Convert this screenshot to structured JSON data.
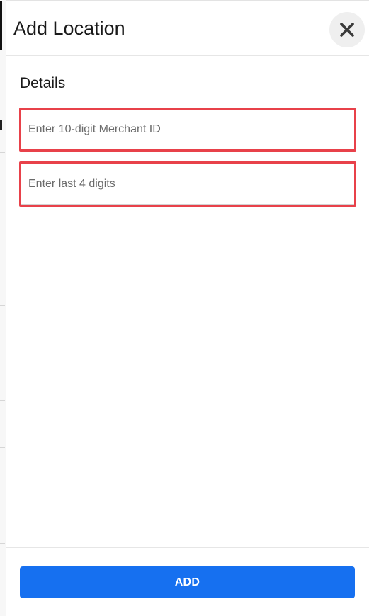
{
  "modal": {
    "title": "Add Location",
    "close_icon": "close-icon"
  },
  "details": {
    "section_title": "Details",
    "merchant_id": {
      "placeholder": "Enter 10-digit Merchant ID",
      "value": ""
    },
    "last_four": {
      "placeholder": "Enter last 4 digits",
      "value": ""
    }
  },
  "footer": {
    "add_label": "ADD"
  },
  "colors": {
    "accent": "#1670f0",
    "error_outline": "#e8414a"
  }
}
